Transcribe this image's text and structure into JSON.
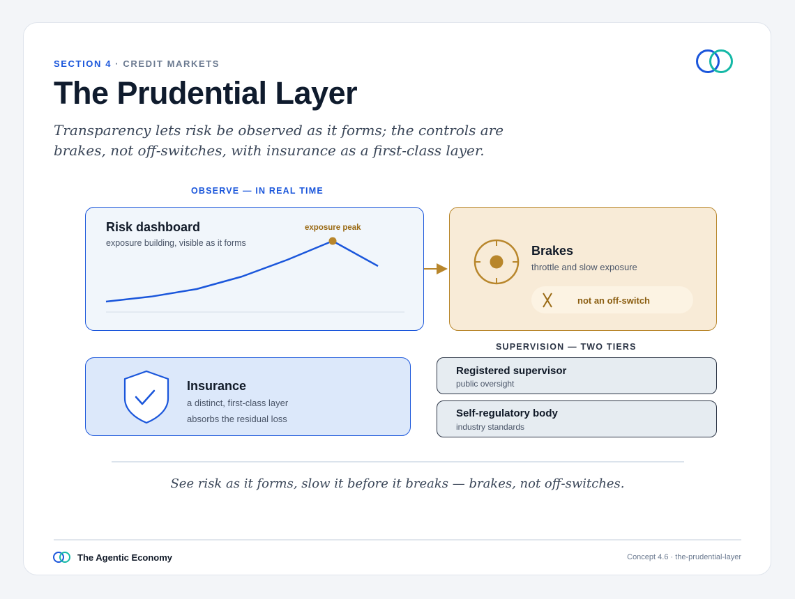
{
  "header": {
    "section": "SECTION 4",
    "category": "· CREDIT MARKETS",
    "title": "The Prudential Layer",
    "subtitle": "Transparency lets risk be observed as it forms; the controls are brakes, not off-switches, with insurance as a first-class layer."
  },
  "logo": {
    "icon": "interlocking-rings-icon",
    "colors": [
      "#1a56db",
      "#14b8a6"
    ]
  },
  "observe_label": "OBSERVE — IN REAL TIME",
  "risk_dashboard": {
    "title": "Risk dashboard",
    "subtitle": "exposure building, visible as it forms",
    "peak_label": "exposure peak",
    "series": [
      1,
      2.2,
      4.0,
      7.0,
      11.0,
      15.5,
      9.5
    ],
    "peak_index": 5
  },
  "brakes": {
    "icon": "brake-gauge-icon",
    "title": "Brakes",
    "subtitle": "throttle and slow exposure",
    "badge_icon": "cross-icon",
    "badge": "not an off-switch"
  },
  "insurance": {
    "icon": "shield-check-icon",
    "title": "Insurance",
    "line1": "a distinct, first-class layer",
    "line2": "absorbs the residual loss"
  },
  "supervision": {
    "label": "SUPERVISION — TWO TIERS",
    "tiers": [
      {
        "title": "Registered supervisor",
        "subtitle": "public oversight"
      },
      {
        "title": "Self-regulatory body",
        "subtitle": "industry standards"
      }
    ]
  },
  "quote": "See risk as it forms, slow it before it breaks — brakes, not off-switches.",
  "footer": {
    "brand": "The Agentic Economy",
    "concept": "Concept 4.6 · the-prudential-layer"
  },
  "colors": {
    "accent": "#1a56db",
    "teal": "#14b8a6",
    "amber": "#b8862b",
    "ink": "#0f1b2d"
  }
}
